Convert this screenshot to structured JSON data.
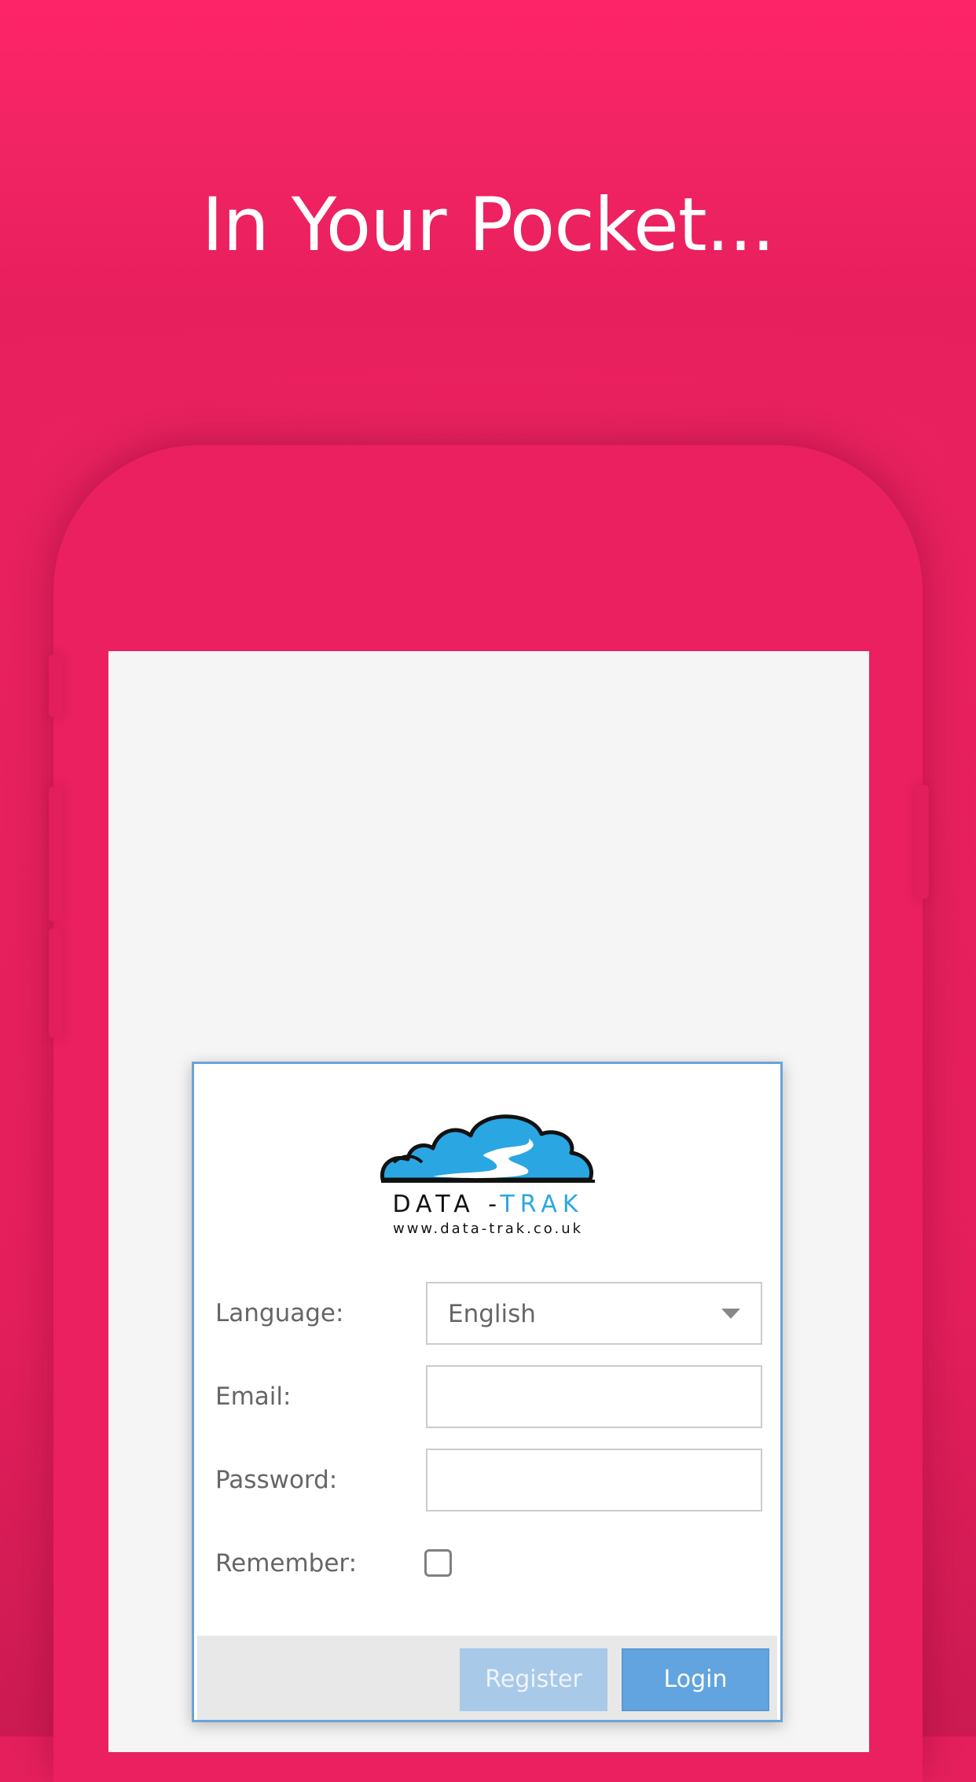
{
  "headline": "In Your Pocket...",
  "colors": {
    "background": "#e91f5d",
    "card_border": "#6aa4d8",
    "logo_blue": "#2aa7e2",
    "register_button": "#a9c9e8",
    "login_button": "#62a4e0"
  },
  "logo": {
    "word_part1": "DATA -",
    "word_part2": "TRAK",
    "url": "www.data-trak.co.uk",
    "icon": "cloud-river-logo"
  },
  "form": {
    "language_label": "Language:",
    "language_value": "English",
    "language_icon": "dropdown-caret-icon",
    "email_label": "Email:",
    "email_value": "",
    "password_label": "Password:",
    "password_value": "",
    "remember_label": "Remember:",
    "remember_checked": false
  },
  "buttons": {
    "register": "Register",
    "login": "Login"
  }
}
